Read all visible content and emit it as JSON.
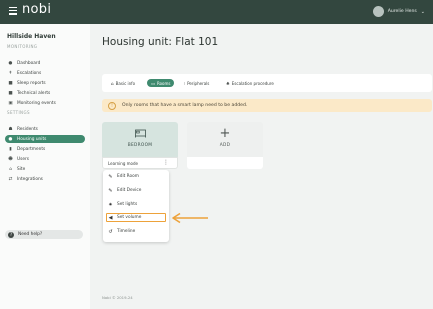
{
  "app": {
    "logo": "nobi",
    "user_name": "Aurelie Hens"
  },
  "sidebar": {
    "org_name": "Hillside Haven",
    "sections": {
      "monitoring": "MONITORING",
      "settings": "SETTINGS"
    },
    "monitoring_items": [
      {
        "label": "Dashboard",
        "icon": "dashboard-icon"
      },
      {
        "label": "Escalations",
        "icon": "escalation-icon"
      },
      {
        "label": "Sleep reports",
        "icon": "sleep-report-icon"
      },
      {
        "label": "Technical alerts",
        "icon": "technical-alert-icon"
      },
      {
        "label": "Monitoring events",
        "icon": "monitoring-events-icon"
      }
    ],
    "settings_items": [
      {
        "label": "Residents",
        "icon": "residents-icon"
      },
      {
        "label": "Housing units",
        "icon": "housing-units-icon",
        "active": true
      },
      {
        "label": "Departments",
        "icon": "departments-icon"
      },
      {
        "label": "Users",
        "icon": "users-icon"
      },
      {
        "label": "Site",
        "icon": "site-icon"
      },
      {
        "label": "Integrations",
        "icon": "integrations-icon"
      }
    ],
    "help_label": "Need help?"
  },
  "main": {
    "title": "Housing unit: Flat 101",
    "tabs": [
      {
        "label": "Basic info",
        "icon": "info-icon"
      },
      {
        "label": "Rooms",
        "icon": "rooms-icon",
        "active": true
      },
      {
        "label": "Peripherals",
        "icon": "peripherals-icon"
      },
      {
        "label": "Escalation procedure",
        "icon": "escalation-procedure-icon"
      }
    ],
    "warning": "Only rooms that have a smart lamp need to be added.",
    "room_card": {
      "label": "BEDROOM",
      "mode": "Learning mode"
    },
    "add_card": {
      "label": "ADD"
    },
    "context_menu": [
      {
        "label": "Edit Room",
        "icon": "pencil-icon"
      },
      {
        "label": "Edit Device",
        "icon": "pencil-icon"
      },
      {
        "label": "Set lights",
        "icon": "lightbulb-icon"
      },
      {
        "label": "Set volume",
        "icon": "volume-icon",
        "highlighted": true
      },
      {
        "label": "Timeline",
        "icon": "history-icon"
      }
    ],
    "footer": "Nobi © 2019-24"
  },
  "colors": {
    "topbar": "#33473f",
    "accent": "#3f8a6f",
    "warning_bg": "#fbe9c8",
    "highlight": "#eda23a"
  }
}
